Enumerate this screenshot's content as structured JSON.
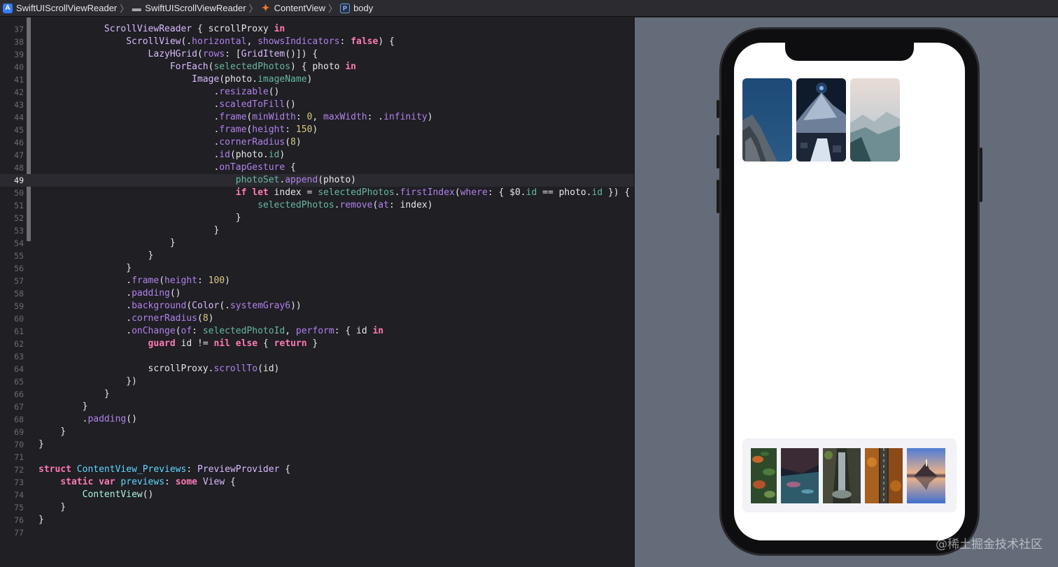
{
  "jumpbar": {
    "crumbs": [
      {
        "label": "SwiftUIScrollViewReader",
        "icon": "app-icon"
      },
      {
        "label": "SwiftUIScrollViewReader",
        "icon": "folder-icon"
      },
      {
        "label": "ContentView",
        "icon": "swift-file-icon"
      },
      {
        "label": "body",
        "icon": "property-icon"
      }
    ],
    "separator": "〉",
    "icon_glyphs": {
      "app": "A",
      "folder": "▬",
      "swift": "✦",
      "prop": "P"
    }
  },
  "editor": {
    "first_line": 37,
    "active_line": 49,
    "lines": [
      [
        [
          "            ",
          "pl"
        ],
        [
          "ScrollViewReader",
          "ty"
        ],
        [
          " { scrollProxy ",
          "pl"
        ],
        [
          "in",
          "kw"
        ]
      ],
      [
        [
          "                ",
          "pl"
        ],
        [
          "ScrollView",
          "ty"
        ],
        [
          "(.",
          "pl"
        ],
        [
          "horizontal",
          "fn"
        ],
        [
          ", ",
          "pl"
        ],
        [
          "showsIndicators",
          "fn"
        ],
        [
          ": ",
          "pl"
        ],
        [
          "false",
          "kw"
        ],
        [
          ") {",
          "pl"
        ]
      ],
      [
        [
          "                    ",
          "pl"
        ],
        [
          "LazyHGrid",
          "ty"
        ],
        [
          "(",
          "pl"
        ],
        [
          "rows",
          "fn"
        ],
        [
          ": [",
          "pl"
        ],
        [
          "GridItem",
          "ty"
        ],
        [
          "()]) {",
          "pl"
        ]
      ],
      [
        [
          "                        ",
          "pl"
        ],
        [
          "ForEach",
          "ty"
        ],
        [
          "(",
          "pl"
        ],
        [
          "selectedPhotos",
          "pr"
        ],
        [
          ") { photo ",
          "pl"
        ],
        [
          "in",
          "kw"
        ]
      ],
      [
        [
          "                            ",
          "pl"
        ],
        [
          "Image",
          "ty"
        ],
        [
          "(photo.",
          "pl"
        ],
        [
          "imageName",
          "pr"
        ],
        [
          ")",
          "pl"
        ]
      ],
      [
        [
          "                                .",
          "pl"
        ],
        [
          "resizable",
          "fn"
        ],
        [
          "()",
          "pl"
        ]
      ],
      [
        [
          "                                .",
          "pl"
        ],
        [
          "scaledToFill",
          "fn"
        ],
        [
          "()",
          "pl"
        ]
      ],
      [
        [
          "                                .",
          "pl"
        ],
        [
          "frame",
          "fn"
        ],
        [
          "(",
          "pl"
        ],
        [
          "minWidth",
          "fn"
        ],
        [
          ": ",
          "pl"
        ],
        [
          "0",
          "nu"
        ],
        [
          ", ",
          "pl"
        ],
        [
          "maxWidth",
          "fn"
        ],
        [
          ": .",
          "pl"
        ],
        [
          "infinity",
          "fn"
        ],
        [
          ")",
          "pl"
        ]
      ],
      [
        [
          "                                .",
          "pl"
        ],
        [
          "frame",
          "fn"
        ],
        [
          "(",
          "pl"
        ],
        [
          "height",
          "fn"
        ],
        [
          ": ",
          "pl"
        ],
        [
          "150",
          "nu"
        ],
        [
          ")",
          "pl"
        ]
      ],
      [
        [
          "                                .",
          "pl"
        ],
        [
          "cornerRadius",
          "fn"
        ],
        [
          "(",
          "pl"
        ],
        [
          "8",
          "nu"
        ],
        [
          ")",
          "pl"
        ]
      ],
      [
        [
          "                                .",
          "pl"
        ],
        [
          "id",
          "fn"
        ],
        [
          "(photo.",
          "pl"
        ],
        [
          "id",
          "pr"
        ],
        [
          ")",
          "pl"
        ]
      ],
      [
        [
          "                                .",
          "pl"
        ],
        [
          "onTapGesture",
          "fn"
        ],
        [
          " {",
          "pl"
        ]
      ],
      [
        [
          "                                    ",
          "pl"
        ],
        [
          "photoSet",
          "pr"
        ],
        [
          ".",
          "pl"
        ],
        [
          "append",
          "fn"
        ],
        [
          "(photo)",
          "pl"
        ]
      ],
      [
        [
          "                                    ",
          "pl"
        ],
        [
          "if",
          "kw"
        ],
        [
          " ",
          "pl"
        ],
        [
          "let",
          "kw"
        ],
        [
          " index = ",
          "pl"
        ],
        [
          "selectedPhotos",
          "pr"
        ],
        [
          ".",
          "pl"
        ],
        [
          "firstIndex",
          "fn"
        ],
        [
          "(",
          "pl"
        ],
        [
          "where",
          "fn"
        ],
        [
          ": { $0.",
          "pl"
        ],
        [
          "id",
          "pr"
        ],
        [
          " == photo.",
          "pl"
        ],
        [
          "id",
          "pr"
        ],
        [
          " }) {",
          "pl"
        ]
      ],
      [
        [
          "                                        ",
          "pl"
        ],
        [
          "selectedPhotos",
          "pr"
        ],
        [
          ".",
          "pl"
        ],
        [
          "remove",
          "fn"
        ],
        [
          "(",
          "pl"
        ],
        [
          "at",
          "fn"
        ],
        [
          ": index)",
          "pl"
        ]
      ],
      [
        [
          "                                    }",
          "pl"
        ]
      ],
      [
        [
          "                                }",
          "pl"
        ]
      ],
      [
        [
          "                        }",
          "pl"
        ]
      ],
      [
        [
          "                    }",
          "pl"
        ]
      ],
      [
        [
          "                }",
          "pl"
        ]
      ],
      [
        [
          "                .",
          "pl"
        ],
        [
          "frame",
          "fn"
        ],
        [
          "(",
          "pl"
        ],
        [
          "height",
          "fn"
        ],
        [
          ": ",
          "pl"
        ],
        [
          "100",
          "nu"
        ],
        [
          ")",
          "pl"
        ]
      ],
      [
        [
          "                .",
          "pl"
        ],
        [
          "padding",
          "fn"
        ],
        [
          "()",
          "pl"
        ]
      ],
      [
        [
          "                .",
          "pl"
        ],
        [
          "background",
          "fn"
        ],
        [
          "(",
          "pl"
        ],
        [
          "Color",
          "ty"
        ],
        [
          "(.",
          "pl"
        ],
        [
          "systemGray6",
          "fn"
        ],
        [
          "))",
          "pl"
        ]
      ],
      [
        [
          "                .",
          "pl"
        ],
        [
          "cornerRadius",
          "fn"
        ],
        [
          "(",
          "pl"
        ],
        [
          "8",
          "nu"
        ],
        [
          ")",
          "pl"
        ]
      ],
      [
        [
          "                .",
          "pl"
        ],
        [
          "onChange",
          "fn"
        ],
        [
          "(",
          "pl"
        ],
        [
          "of",
          "fn"
        ],
        [
          ": ",
          "pl"
        ],
        [
          "selectedPhotoId",
          "pr"
        ],
        [
          ", ",
          "pl"
        ],
        [
          "perform",
          "fn"
        ],
        [
          ": { id ",
          "pl"
        ],
        [
          "in",
          "kw"
        ]
      ],
      [
        [
          "                    ",
          "pl"
        ],
        [
          "guard",
          "kw"
        ],
        [
          " id != ",
          "pl"
        ],
        [
          "nil",
          "kw"
        ],
        [
          " ",
          "pl"
        ],
        [
          "else",
          "kw"
        ],
        [
          " { ",
          "pl"
        ],
        [
          "return",
          "kw"
        ],
        [
          " }",
          "pl"
        ]
      ],
      [
        [
          "",
          "pl"
        ]
      ],
      [
        [
          "                    scrollProxy.",
          "pl"
        ],
        [
          "scrollTo",
          "fn"
        ],
        [
          "(id)",
          "pl"
        ]
      ],
      [
        [
          "                })",
          "pl"
        ]
      ],
      [
        [
          "            }",
          "pl"
        ]
      ],
      [
        [
          "        }",
          "pl"
        ]
      ],
      [
        [
          "        .",
          "pl"
        ],
        [
          "padding",
          "fn"
        ],
        [
          "()",
          "pl"
        ]
      ],
      [
        [
          "    }",
          "pl"
        ]
      ],
      [
        [
          "}",
          "pl"
        ]
      ],
      [
        [
          "",
          "pl"
        ]
      ],
      [
        [
          "struct",
          "kw"
        ],
        [
          " ",
          "pl"
        ],
        [
          "ContentView_Previews",
          "de"
        ],
        [
          ": ",
          "pl"
        ],
        [
          "PreviewProvider",
          "ty"
        ],
        [
          " {",
          "pl"
        ]
      ],
      [
        [
          "    ",
          "pl"
        ],
        [
          "static",
          "kw"
        ],
        [
          " ",
          "pl"
        ],
        [
          "var",
          "kw"
        ],
        [
          " ",
          "pl"
        ],
        [
          "previews",
          "de"
        ],
        [
          ": ",
          "pl"
        ],
        [
          "some",
          "kw"
        ],
        [
          " ",
          "pl"
        ],
        [
          "View",
          "ty"
        ],
        [
          " {",
          "pl"
        ]
      ],
      [
        [
          "        ",
          "pl"
        ],
        [
          "ContentView",
          "ot"
        ],
        [
          "()",
          "pl"
        ]
      ],
      [
        [
          "    }",
          "pl"
        ]
      ],
      [
        [
          "}",
          "pl"
        ]
      ],
      [
        [
          "",
          "pl"
        ]
      ]
    ]
  },
  "preview": {
    "selected_photos": [
      {
        "name": "selected-photo-1",
        "scene": "mountain-rock-blue-sky"
      },
      {
        "name": "selected-photo-2",
        "scene": "snowy-mountain-night"
      },
      {
        "name": "selected-photo-3",
        "scene": "misty-forest-mountains"
      }
    ],
    "thumbnails": [
      {
        "name": "thumbnail-1",
        "scene": "leaves-closeup"
      },
      {
        "name": "thumbnail-2",
        "scene": "reflection-water"
      },
      {
        "name": "thumbnail-3",
        "scene": "waterfall-cave"
      },
      {
        "name": "thumbnail-4",
        "scene": "autumn-road"
      },
      {
        "name": "thumbnail-5",
        "scene": "lake-island-church"
      }
    ]
  },
  "watermark": "@稀土掘金技术社区",
  "colors": {
    "editor_bg": "#1f1f24",
    "keyword": "#ff7ab2",
    "type": "#dabaff",
    "method": "#b281eb",
    "property": "#67b7a4",
    "number": "#d9c97c",
    "canvas_bg": "#646c7a"
  }
}
